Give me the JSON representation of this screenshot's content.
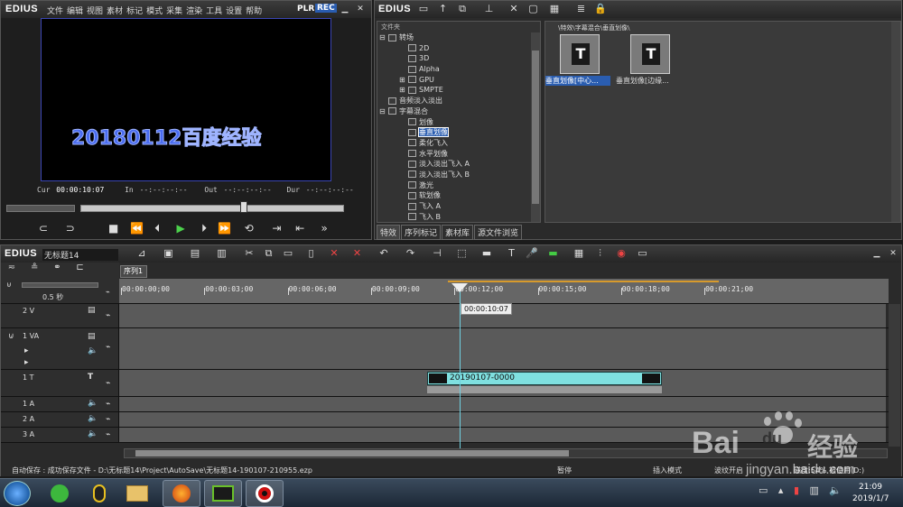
{
  "player": {
    "logo": "EDIUS",
    "menu": [
      "文件",
      "编辑",
      "视图",
      "素材",
      "标记",
      "模式",
      "采集",
      "渲染",
      "工具",
      "设置",
      "帮助"
    ],
    "plr": "PLR",
    "rec": "REC",
    "overlay_text": "20180112百度经验",
    "cur_label": "Cur",
    "cur_value": "00:00:10:07",
    "in_label": "In",
    "in_value": "--:--:--:--",
    "out_label": "Out",
    "out_value": "--:--:--:--",
    "dur_label": "Dur",
    "dur_value": "--:--:--:--"
  },
  "library": {
    "logo": "EDIUS",
    "folder_header": "文件夹",
    "path": "\\特效\\字幕混合\\垂直划像\\",
    "tree": [
      {
        "label": "转场",
        "indent": 1,
        "expander": "⊟"
      },
      {
        "label": "2D",
        "indent": 2,
        "expander": ""
      },
      {
        "label": "3D",
        "indent": 2,
        "expander": ""
      },
      {
        "label": "Alpha",
        "indent": 2,
        "expander": ""
      },
      {
        "label": "GPU",
        "indent": 2,
        "expander": "⊞"
      },
      {
        "label": "SMPTE",
        "indent": 2,
        "expander": "⊞"
      },
      {
        "label": "音频淡入淡出",
        "indent": 1,
        "expander": ""
      },
      {
        "label": "字幕混合",
        "indent": 1,
        "expander": "⊟"
      },
      {
        "label": "划像",
        "indent": 2,
        "expander": ""
      },
      {
        "label": "垂直划像",
        "indent": 2,
        "expander": "",
        "selected": true
      },
      {
        "label": "柔化飞入",
        "indent": 2,
        "expander": ""
      },
      {
        "label": "水平划像",
        "indent": 2,
        "expander": ""
      },
      {
        "label": "淡入淡出飞入 A",
        "indent": 2,
        "expander": ""
      },
      {
        "label": "淡入淡出飞入 B",
        "indent": 2,
        "expander": ""
      },
      {
        "label": "激光",
        "indent": 2,
        "expander": ""
      },
      {
        "label": "软划像",
        "indent": 2,
        "expander": ""
      },
      {
        "label": "飞入 A",
        "indent": 2,
        "expander": ""
      },
      {
        "label": "飞入 B",
        "indent": 2,
        "expander": ""
      }
    ],
    "effects": [
      {
        "label": "垂直划像[中心...",
        "selected": true
      },
      {
        "label": "垂直划像[边缘..."
      }
    ],
    "tabs": [
      "特效",
      "序列标记",
      "素材库",
      "源文件浏览"
    ]
  },
  "timeline": {
    "logo": "EDIUS",
    "project_name": "无标题14",
    "sequence_tab": "序列1",
    "zoom": "0.5 秒",
    "ruler": [
      "00:00:00;00",
      "00:00:03;00",
      "00:00:06;00",
      "00:00:09;00",
      "00:00:12;00",
      "00:00:15;00",
      "00:00:18;00",
      "00:00:21;00"
    ],
    "playhead_tc": "00:00:10:07",
    "tracks": [
      {
        "name": "2 V"
      },
      {
        "name": "1 VA"
      },
      {
        "name": "1 T"
      },
      {
        "name": "1 A"
      },
      {
        "name": "2 A"
      },
      {
        "name": "3 A"
      }
    ],
    "clip_label": "20190107-0000"
  },
  "status": {
    "autosave": "自动保存 : 成功保存文件 - D:\\无标题14\\Project\\AutoSave\\无标题14-190107-210955.ezp",
    "pause": "暂停",
    "insert_mode": "插入模式",
    "ripple": "波纹开启",
    "disk": "磁盘:54% 被使用(D:)"
  },
  "taskbar": {
    "time": "21:09",
    "date": "2019/1/7"
  },
  "watermark": {
    "brand": "Bai",
    "brand2": "du",
    "cn": "经验",
    "url": "jingyan.baidu.com"
  }
}
